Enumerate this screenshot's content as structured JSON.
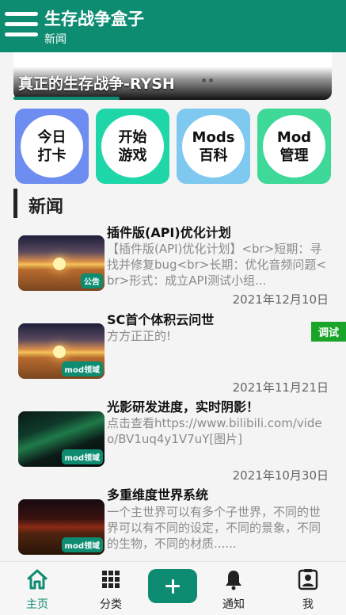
{
  "header": {
    "title": "生存战争盒子",
    "subtitle": "新闻"
  },
  "banner": {
    "title": "真正的生存战争-RYSH"
  },
  "tiles": [
    {
      "label_line1": "今日",
      "label_line2": "打卡",
      "color": "#6d8ef0"
    },
    {
      "label_line1": "开始",
      "label_line2": "游戏",
      "color": "#1fd6a8"
    },
    {
      "label_line1": "Mods",
      "label_line2": "百科",
      "color": "#7fc8f0"
    },
    {
      "label_line1": "Mod",
      "label_line2": "管理",
      "color": "#3ed898"
    }
  ],
  "section": {
    "title": "新闻"
  },
  "news": [
    {
      "title": "插件版(API)优化计划",
      "summary": "【插件版(API)优化计划】<br>短期：寻找并修复bug<br>长期：优化音频问题<br>形式：成立API测试小组...",
      "date": "2021年12月10日",
      "badge": "公告"
    },
    {
      "title": "SC首个体积云问世",
      "summary": "方方正正的!",
      "date": "2021年11月21日",
      "badge": "mod领域"
    },
    {
      "title": "光影研发进度，实时阴影！",
      "summary": "点击查看https://www.bilibili.com/video/BV1uq4y1V7uY[图片]",
      "date": "2021年10月30日",
      "badge": "mod领域"
    },
    {
      "title": "多重维度世界系统",
      "summary": "一个主世界可以有多个子世界，不同的世界可以有不同的设定，不同的景象，不同的生物，不同的材质......",
      "date": "",
      "badge": "mod领域"
    }
  ],
  "debug_button": "调试",
  "bottom_nav": [
    {
      "label": "主页",
      "icon": "home-icon"
    },
    {
      "label": "分类",
      "icon": "grid-icon"
    },
    {
      "label": "",
      "icon": "plus-icon"
    },
    {
      "label": "通知",
      "icon": "bell-icon"
    },
    {
      "label": "我",
      "icon": "profile-icon"
    }
  ],
  "colors": {
    "primary": "#0e8c71",
    "debug": "#1aa52a"
  }
}
